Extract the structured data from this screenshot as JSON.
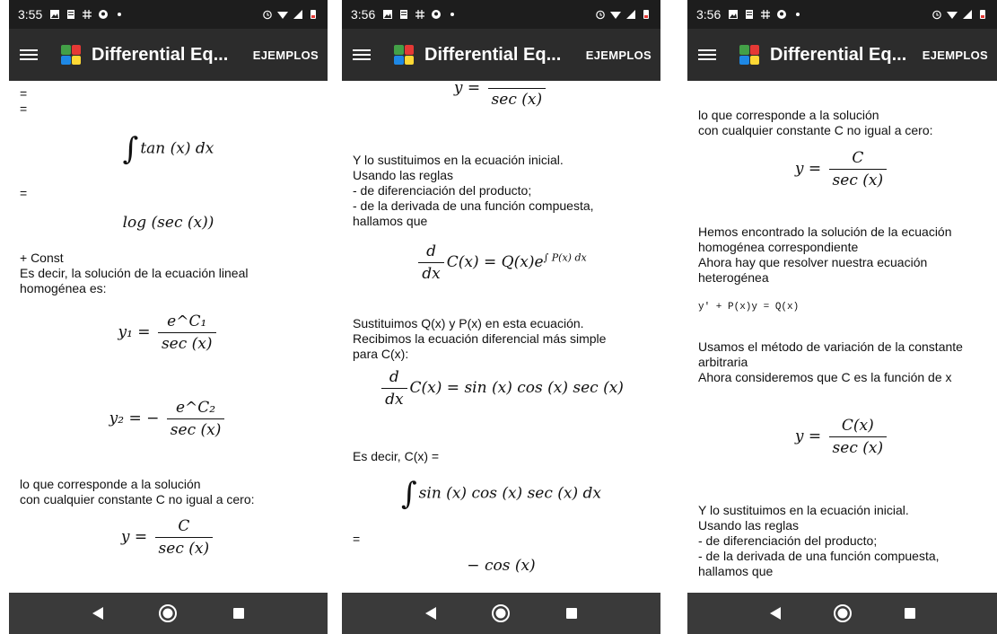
{
  "status_bar": {
    "time_1": "3:55",
    "time_2": "3:56",
    "time_3": "3:56"
  },
  "app_bar": {
    "title": "Differential Eq...",
    "action": "EJEMPLOS"
  },
  "colors": {
    "status_bg": "#1d1d1d",
    "app_bar_bg": "#2c2c2c",
    "nav_bar_bg": "#3a3a3a"
  },
  "screen1": {
    "t1": "=\n=",
    "m_integral": "tan (x) dx",
    "t2": "=",
    "m_log": "log (sec (x))",
    "t3": "+ Const\nEs decir, la solución de la ecuación lineal\nhomogénea es:",
    "m_y1_lhs": "y₁ =",
    "m_y1_num": "e^C₁",
    "m_den": "sec (x)",
    "m_y2_lhs": "y₂ = −",
    "m_y2_num": "e^C₂",
    "t4": "lo que corresponde a la solución\ncon cualquier constante C no igual a cero:",
    "m_y_lhs": "y =",
    "m_y_num": "C"
  },
  "screen2": {
    "m_top_lhs": "y =",
    "m_top_den": "sec (x)",
    "t1": "Y lo sustituimos en la ecuación inicial.\nUsando las reglas\n- de diferenciación del producto;\n- de la derivada de una función compuesta,\nhallamos que",
    "m_eq1_rhs": "C(x) = Q(x)e",
    "m_eq1_exp": "∫ P(x) dx",
    "t2": "Sustituimos Q(x) y P(x) en esta ecuación.\nRecibimos la ecuación diferencial más simple\npara C(x):",
    "m_eq2_rhs": "C(x) = sin (x) cos (x) sec (x)",
    "t3": "Es decir, C(x) =",
    "m_integral": "sin (x) cos (x) sec (x) dx",
    "t4": "=",
    "m_result": "− cos (x)",
    "m_d": "d",
    "m_dx": "dx"
  },
  "screen3": {
    "t1": "lo que corresponde a la solución\ncon cualquier constante C no igual a cero:",
    "m_y_lhs": "y =",
    "m_y_num": "C",
    "m_den": "sec (x)",
    "t2": "Hemos encontrado la solución de la ecuación\nhomogénea correspondiente\nAhora hay que resolver nuestra ecuación\nheterogénea",
    "mono": "y' + P(x)y = Q(x)",
    "t3": "Usamos el método de variación de la constante\narbitraria\nAhora consideremos que C es la función de x",
    "m_cx_num": "C(x)",
    "t4": "Y lo sustituimos en la ecuación inicial.\nUsando las reglas\n- de diferenciación del producto;\n- de la derivada de una función compuesta,\nhallamos que"
  }
}
